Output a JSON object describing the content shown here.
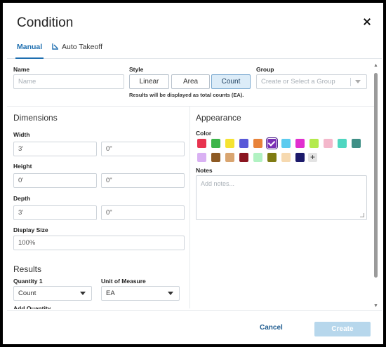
{
  "dialog": {
    "title": "Condition",
    "tabs": [
      {
        "label": "Manual",
        "active": true
      },
      {
        "label": "Auto Takeoff",
        "active": false
      }
    ]
  },
  "name": {
    "label": "Name",
    "placeholder": "Name"
  },
  "style": {
    "label": "Style",
    "options": [
      "Linear",
      "Area",
      "Count"
    ],
    "selected": "Count",
    "hint": "Results will be displayed as total counts (EA)."
  },
  "group": {
    "label": "Group",
    "placeholder": "Create or Select a Group"
  },
  "dimensions": {
    "title": "Dimensions",
    "width": {
      "label": "Width",
      "feet": "3'",
      "inches": "0\""
    },
    "height": {
      "label": "Height",
      "feet": "0'",
      "inches": "0\""
    },
    "depth": {
      "label": "Depth",
      "feet": "3'",
      "inches": "0\""
    },
    "display_size": {
      "label": "Display Size",
      "value": "100%"
    }
  },
  "results": {
    "title": "Results",
    "quantity1": {
      "label": "Quantity 1",
      "value": "Count"
    },
    "unit": {
      "label": "Unit of Measure",
      "value": "EA"
    },
    "add_quantity": "Add Quantity"
  },
  "appearance": {
    "title": "Appearance",
    "color_label": "Color",
    "colors": [
      "#e8334f",
      "#3cb54a",
      "#f5e331",
      "#5959d8",
      "#e8833a",
      "#7a2fb5",
      "#5ccbef",
      "#e12fcf",
      "#b4ea4d",
      "#f4b7cb",
      "#4fd6c0",
      "#3f8f86",
      "#d9b1f3",
      "#8d5a23",
      "#d9a570",
      "#8a1520",
      "#b1f2c2",
      "#7f7b12",
      "#f6d9b0",
      "#1c1a6b"
    ],
    "selected_color": "#7a2fb5",
    "notes_label": "Notes",
    "notes_placeholder": "Add notes..."
  },
  "footer": {
    "cancel": "Cancel",
    "create": "Create"
  }
}
